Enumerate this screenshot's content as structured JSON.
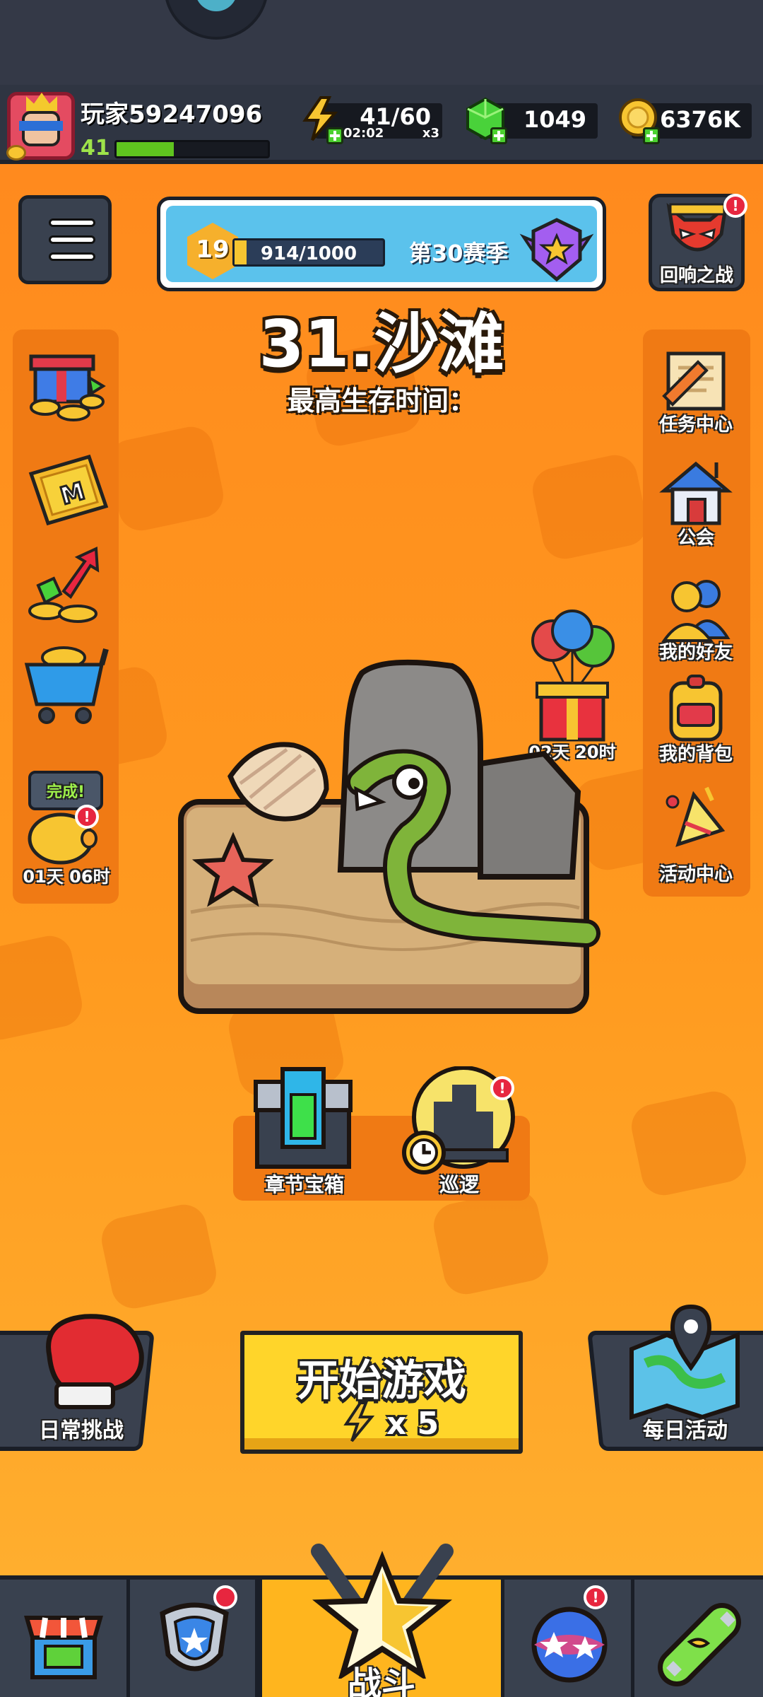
{
  "player": {
    "name": "玩家59247096",
    "level": "41",
    "xp_fraction": 0.38
  },
  "resources": {
    "energy": {
      "value": "41/60",
      "timer": "02:02",
      "multiplier": "x3",
      "icon": "lightning-icon"
    },
    "gems": {
      "value": "1049",
      "icon": "green-gem-icon"
    },
    "gold": {
      "value": "6376K",
      "icon": "gold-coin-icon"
    }
  },
  "season": {
    "level": "19",
    "progress": "914/1000",
    "progress_fraction": 0.914,
    "title": "第30赛季"
  },
  "echo_battle": {
    "label": "回响之战",
    "badge": "!"
  },
  "chapter": {
    "title": "31.沙滩",
    "best_survival": "最高生存时间："
  },
  "left_sidebar": {
    "items": [
      {
        "icon": "gift-box-icon"
      },
      {
        "icon": "monthly-card-icon"
      },
      {
        "icon": "growth-fund-icon"
      },
      {
        "icon": "shop-cart-icon"
      },
      {
        "icon": "piggy-bank-icon",
        "bubble": "完成!",
        "timer": "01天 06时",
        "badge": "!"
      }
    ]
  },
  "right_sidebar": {
    "items": [
      {
        "label": "任务中心",
        "icon": "scroll-icon"
      },
      {
        "label": "公会",
        "icon": "guild-house-icon"
      },
      {
        "label": "我的好友",
        "icon": "friends-icon"
      },
      {
        "label": "我的背包",
        "icon": "backpack-icon"
      },
      {
        "label": "活动中心",
        "icon": "party-popper-icon"
      }
    ]
  },
  "balloon_gift": {
    "timer": "02天 20时"
  },
  "chapter_chest": {
    "label": "章节宝箱"
  },
  "patrol": {
    "label": "巡逻",
    "badge": "!"
  },
  "start_game": {
    "label": "开始游戏",
    "cost": "x 5"
  },
  "daily_challenge": {
    "label": "日常挑战"
  },
  "daily_activity": {
    "label": "每日活动"
  },
  "bottom_nav": {
    "items": [
      {
        "name": "shop",
        "icon": "shop-icon"
      },
      {
        "name": "equipment",
        "icon": "shield-icon",
        "badge": "lock"
      },
      {
        "name": "battle",
        "label": "战斗",
        "icon": "star-swords-icon",
        "active": true
      },
      {
        "name": "talent",
        "icon": "star-orb-icon",
        "badge": "!"
      },
      {
        "name": "evolution",
        "icon": "dna-capsule-icon"
      }
    ]
  },
  "colors": {
    "bg_orange": "#ff9a1f",
    "accent_yellow": "#ffd52a",
    "panel_dark": "#39414f",
    "alert_red": "#e7263f"
  }
}
